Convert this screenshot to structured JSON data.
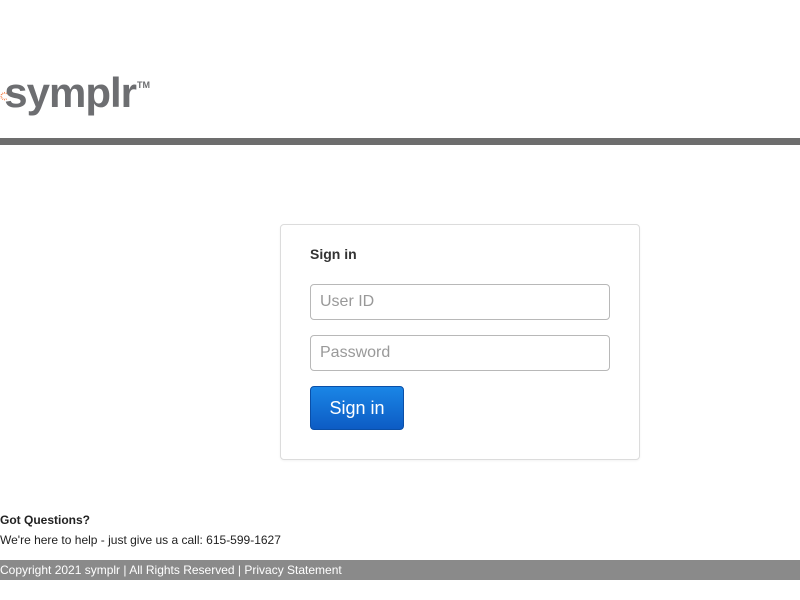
{
  "brand": {
    "name": "symplr",
    "trademark": "TM",
    "sun_color": "#f26522",
    "text_color": "#6d6e71"
  },
  "login": {
    "title": "Sign in",
    "user_placeholder": "User ID",
    "user_value": "",
    "password_placeholder": "Password",
    "password_value": "",
    "submit_label": "Sign in",
    "button_color": "#1170d6"
  },
  "help": {
    "title": "Got Questions?",
    "text": "We're here to help - just give us a call: 615-599-1627"
  },
  "footer": {
    "copyright": "Copyright 2021 symplr",
    "rights": "All Rights Reserved",
    "separator": " | ",
    "privacy_link": "Privacy Statement"
  }
}
